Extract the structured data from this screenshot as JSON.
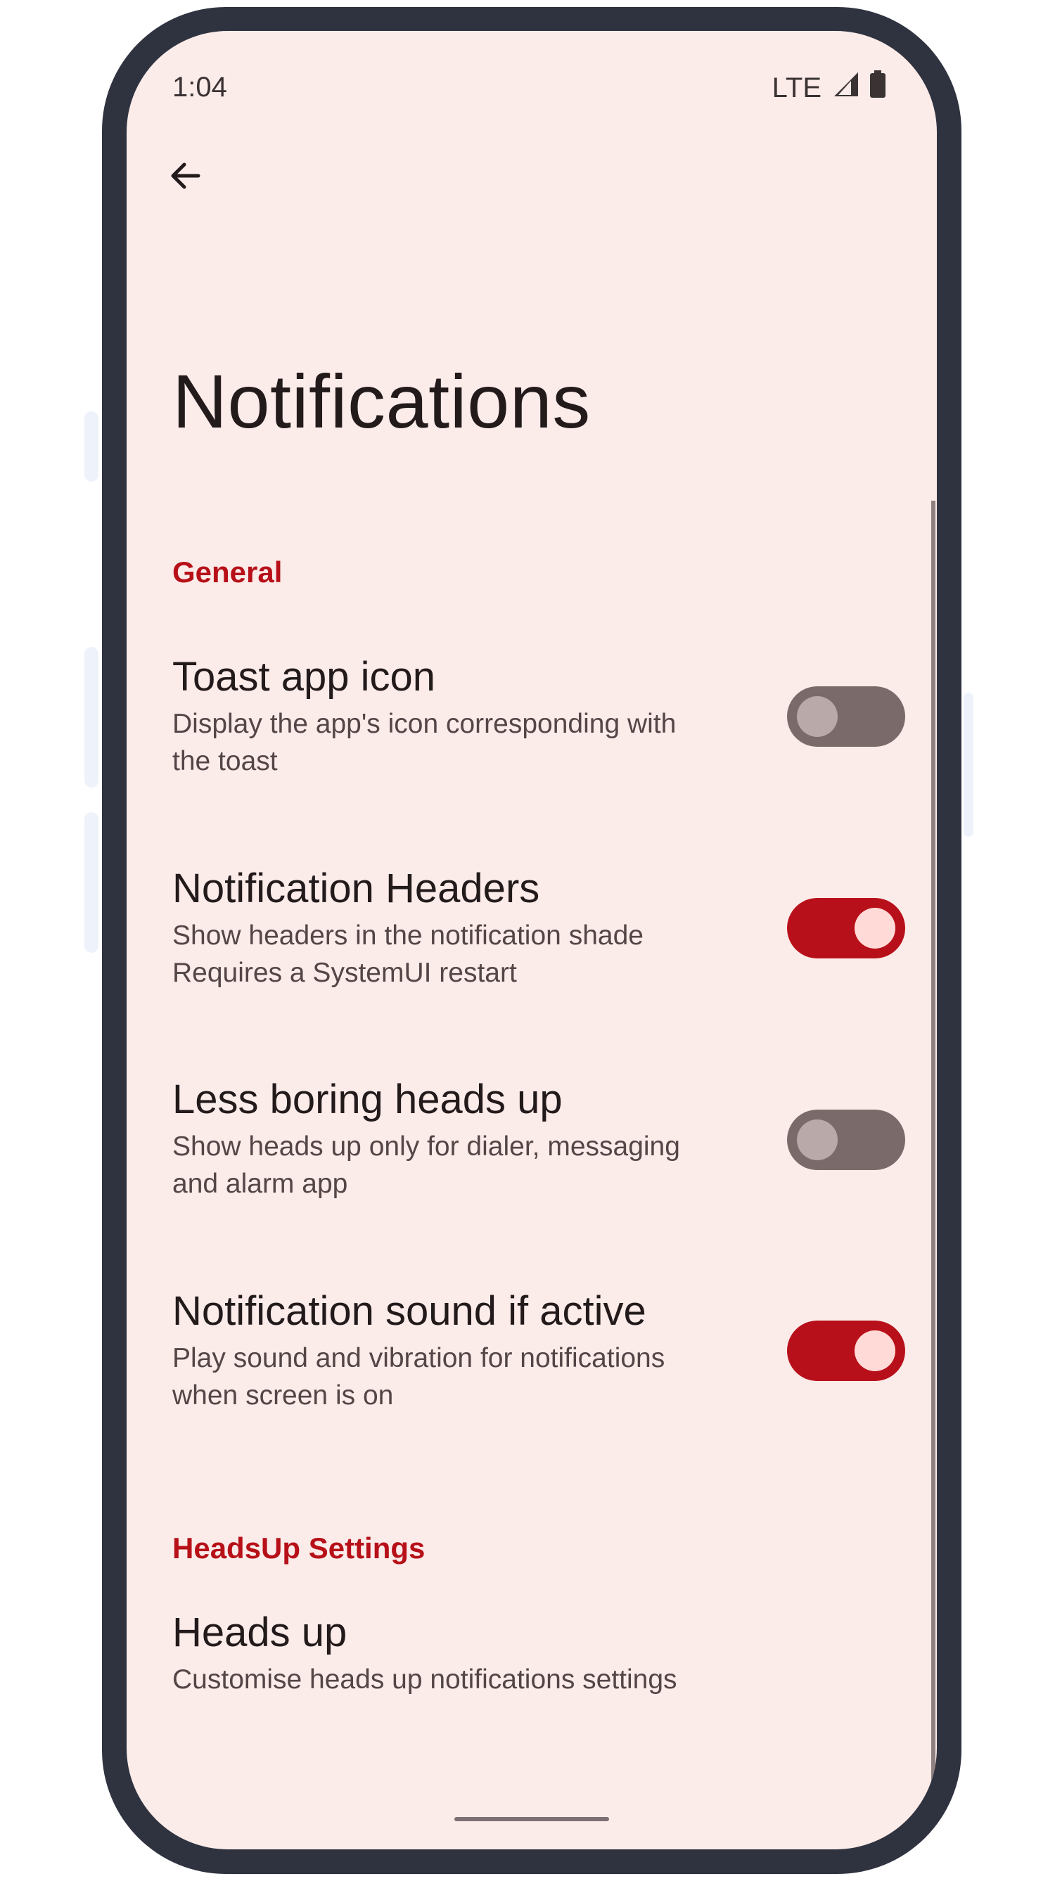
{
  "status_bar": {
    "time": "1:04",
    "network": "LTE"
  },
  "page": {
    "title": "Notifications"
  },
  "sections": [
    {
      "header": "General",
      "items": [
        {
          "title": "Toast app icon",
          "subtitle": "Display the app's icon corresponding with\nthe toast",
          "toggle_on": false
        },
        {
          "title": "Notification Headers",
          "subtitle": "Show headers in the notification shade\nRequires a SystemUI restart",
          "toggle_on": true
        },
        {
          "title": "Less boring heads up",
          "subtitle": "Show heads up only for dialer, messaging\nand alarm app",
          "toggle_on": false
        },
        {
          "title": "Notification sound if active",
          "subtitle": "Play sound and vibration for notifications\nwhen screen is on",
          "toggle_on": true
        }
      ]
    },
    {
      "header": "HeadsUp Settings",
      "items": [
        {
          "title": "Heads up",
          "subtitle": "Customise heads up notifications settings"
        }
      ]
    }
  ],
  "colors": {
    "accent": "#b8101a",
    "background": "#fbecea",
    "frame": "#2f3340",
    "switch_off_track": "#7b6a6a",
    "switch_on_thumb": "#ffdad7"
  },
  "icons": [
    "back-arrow-icon",
    "signal-icon",
    "battery-icon"
  ]
}
